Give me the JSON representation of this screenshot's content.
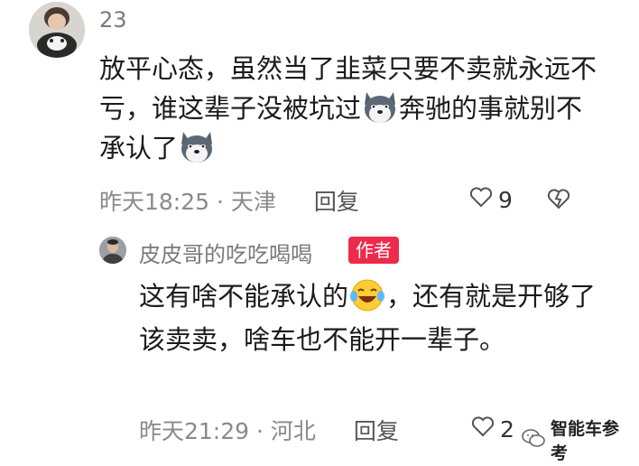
{
  "comment": {
    "username": "23",
    "text_parts": [
      "放平心态，虽然当了韭菜只要不卖就永远不亏，谁这辈子没被坑过",
      "奔驰的事就别不承认了"
    ],
    "time": "昨天18:25",
    "location": "天津",
    "reply_label": "回复",
    "likes": "9",
    "emoji": "husky-doge-emoji"
  },
  "reply": {
    "username": "皮皮哥的吃吃喝喝",
    "author_badge": "作者",
    "text_parts": [
      "这有啥不能承认的",
      "，还有就是开够了该卖卖，啥车也不能开一辈子。"
    ],
    "time": "昨天21:29",
    "location": "河北",
    "reply_label": "回复",
    "likes": "2",
    "emoji": "laughing-tears-emoji"
  },
  "watermark": {
    "text": "智能车参考",
    "icon": "wechat-icon"
  },
  "colors": {
    "badge": "#ee2a4c",
    "meta": "#8a8a8a",
    "text": "#1b1b1b"
  }
}
